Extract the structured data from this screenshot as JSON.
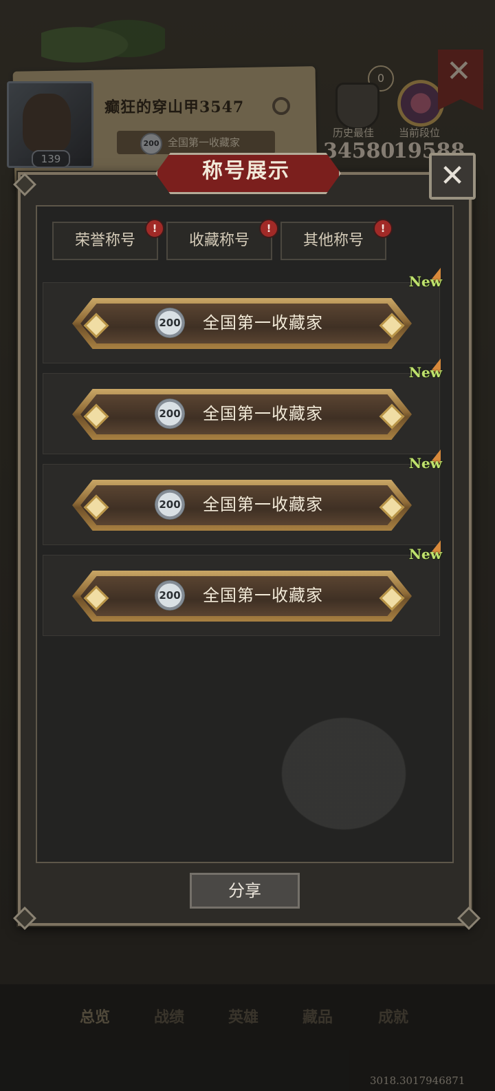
{
  "background": {
    "player_name": "癫狂的穿山甲3547",
    "level": "139",
    "current_title": "全国第一收藏家",
    "title_medal_value": "200",
    "rank_counter": "0",
    "stats": [
      {
        "label": "历史最佳",
        "value": "34580"
      },
      {
        "label": "当前段位",
        "value": "19588"
      }
    ],
    "bottom_nav": [
      "总览",
      "战绩",
      "英雄",
      "藏品",
      "成就"
    ],
    "active_nav_index": 0,
    "coordinates": "3018.3017946871"
  },
  "modal": {
    "title": "称号展示",
    "tabs": [
      {
        "label": "荣誉称号",
        "alert": "!"
      },
      {
        "label": "收藏称号",
        "alert": "!"
      },
      {
        "label": "其他称号",
        "alert": "!"
      }
    ],
    "rows": [
      {
        "medal": "200",
        "title": "全国第一收藏家",
        "badge": "New"
      },
      {
        "medal": "200",
        "title": "全国第一收藏家",
        "badge": "New"
      },
      {
        "medal": "200",
        "title": "全国第一收藏家",
        "badge": "New"
      },
      {
        "medal": "200",
        "title": "全国第一收藏家",
        "badge": "New"
      }
    ],
    "share_label": "分享"
  },
  "colors": {
    "accent_red": "#7b1f1d",
    "gold": "#caa766",
    "new_green": "#bfe26d"
  }
}
